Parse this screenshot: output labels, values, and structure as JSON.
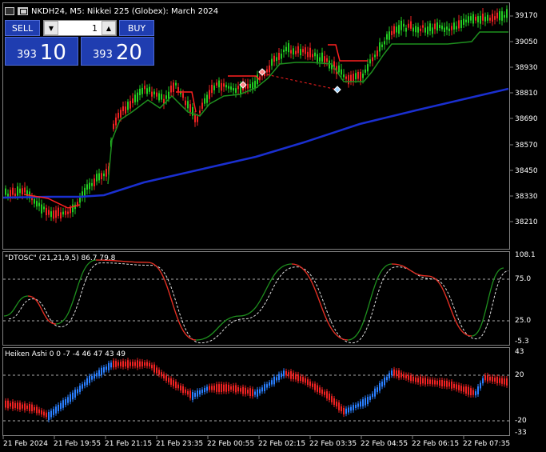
{
  "header": {
    "symbol_title": "NKDH24, M5:  Nikkei 225 (Globex): March 2024"
  },
  "trade_panel": {
    "sell_label": "SELL",
    "buy_label": "BUY",
    "volume": "1",
    "sell_price_prefix": "393",
    "sell_price_big": "10",
    "buy_price_prefix": "393",
    "buy_price_big": "20"
  },
  "price_axis": [
    "39170",
    "39050",
    "38930",
    "38810",
    "38690",
    "38570",
    "38450",
    "38330",
    "38210"
  ],
  "indicators": {
    "dtosc_label": "\"DTOSC\" (21,21,9,5) 86.7 79.8",
    "dtosc_axis": [
      "108.1",
      "75.0",
      "25.0",
      "-5.3"
    ],
    "heiken_label": "Heiken Ashi 0 0 -7 -4 46 47 43 49",
    "heiken_axis": [
      "43",
      "20",
      "-20",
      "-33"
    ]
  },
  "time_axis": [
    "21 Feb 2024",
    "21 Feb 19:55",
    "21 Feb 21:15",
    "21 Feb 23:35",
    "22 Feb 00:55",
    "22 Feb 02:15",
    "22 Feb 03:35",
    "22 Feb 04:55",
    "22 Feb 06:15",
    "22 Feb 07:35"
  ],
  "colors": {
    "bull": "#22cc22",
    "bear": "#ee2222",
    "ma": "#1a2fd0",
    "support": "#1e8f1e",
    "resist": "#ff2020",
    "ha_bull": "#2a7fff",
    "ha_bear": "#ee2222",
    "grid": "#808080"
  }
}
